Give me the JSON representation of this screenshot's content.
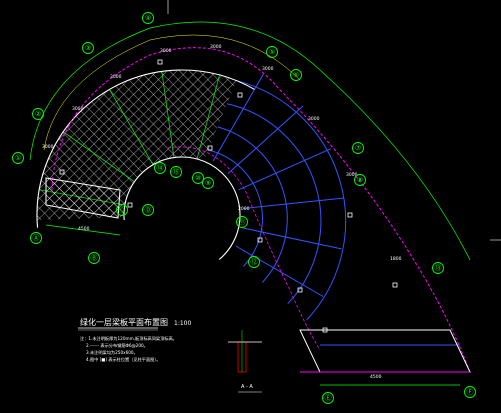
{
  "drawing": {
    "title": "绿化一层梁板平面布置图",
    "scale": "1:100",
    "notes": [
      "注：1.未注明板厚为120mm,板顶标高同梁顶标高。",
      "2.------ 表示分布钢筋Φ6@200。",
      "3.未注明梁均为250x600。",
      "4.图中 [■] 表示柱位置（见柱平面图）。"
    ],
    "section_label": "A - A"
  },
  "axes": {
    "numeric": [
      "①",
      "②",
      "③",
      "④",
      "⑤",
      "⑥",
      "⑦",
      "⑧",
      "⑨",
      "⑩",
      "⑪",
      "⑫",
      "⑬",
      "⑭",
      "⑮"
    ],
    "lettered": [
      "Ⓐ",
      "Ⓑ",
      "Ⓒ",
      "Ⓓ",
      "Ⓔ",
      "Ⓕ"
    ]
  },
  "dimensions": [
    "3000",
    "3000",
    "3000",
    "3000",
    "3000",
    "3000",
    "3000",
    "3000",
    "4500",
    "4500",
    "1800",
    "2000"
  ],
  "colors": {
    "background": "#000000",
    "axis": "#00ff00",
    "beam": "#3355ff",
    "slab": "#ffffff",
    "edge": "#ff00ff",
    "rail": "#ffff00"
  }
}
